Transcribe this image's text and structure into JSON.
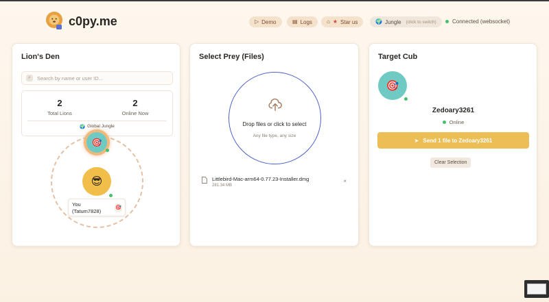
{
  "header": {
    "brand": "c0py.me",
    "demo": "Demo",
    "logs": "Logs",
    "star": "Star us",
    "jungle": "Jungle",
    "jungle_hint": "(click to switch)",
    "status": "Connected (websocket)"
  },
  "den": {
    "title": "Lion's Den",
    "search_placeholder": "Search by name or user ID...",
    "total_value": "2",
    "total_label": "Total Lions",
    "online_value": "2",
    "online_label": "Online Now",
    "global": "Global Jungle",
    "you_line1": "You",
    "you_line2": "(Tatum7828)"
  },
  "prey": {
    "title": "Select Prey (Files)",
    "drop_title": "Drop files or click to select",
    "drop_sub": "Any file type, any size",
    "file_name": "Littlebird-Mac-arm64-0.77.23-Installer.dmg",
    "file_size": "281.34 MB",
    "remove": "×"
  },
  "cub": {
    "title": "Target Cub",
    "name": "Zedoary3261",
    "status": "Online",
    "send": "Send 1 file to Zedoary3261",
    "clear": "Clear Selection"
  },
  "icons": {
    "demo": "▷",
    "logs": "▤",
    "star": "★",
    "github": "⌂",
    "globe": "🌍",
    "target": "🎯",
    "sunglasses": "😎",
    "send": "➤"
  },
  "colors": {
    "accent": "#ecbf56",
    "teal": "#6fcac4",
    "drop_ring": "#4d62c8",
    "online": "#45c06a"
  }
}
